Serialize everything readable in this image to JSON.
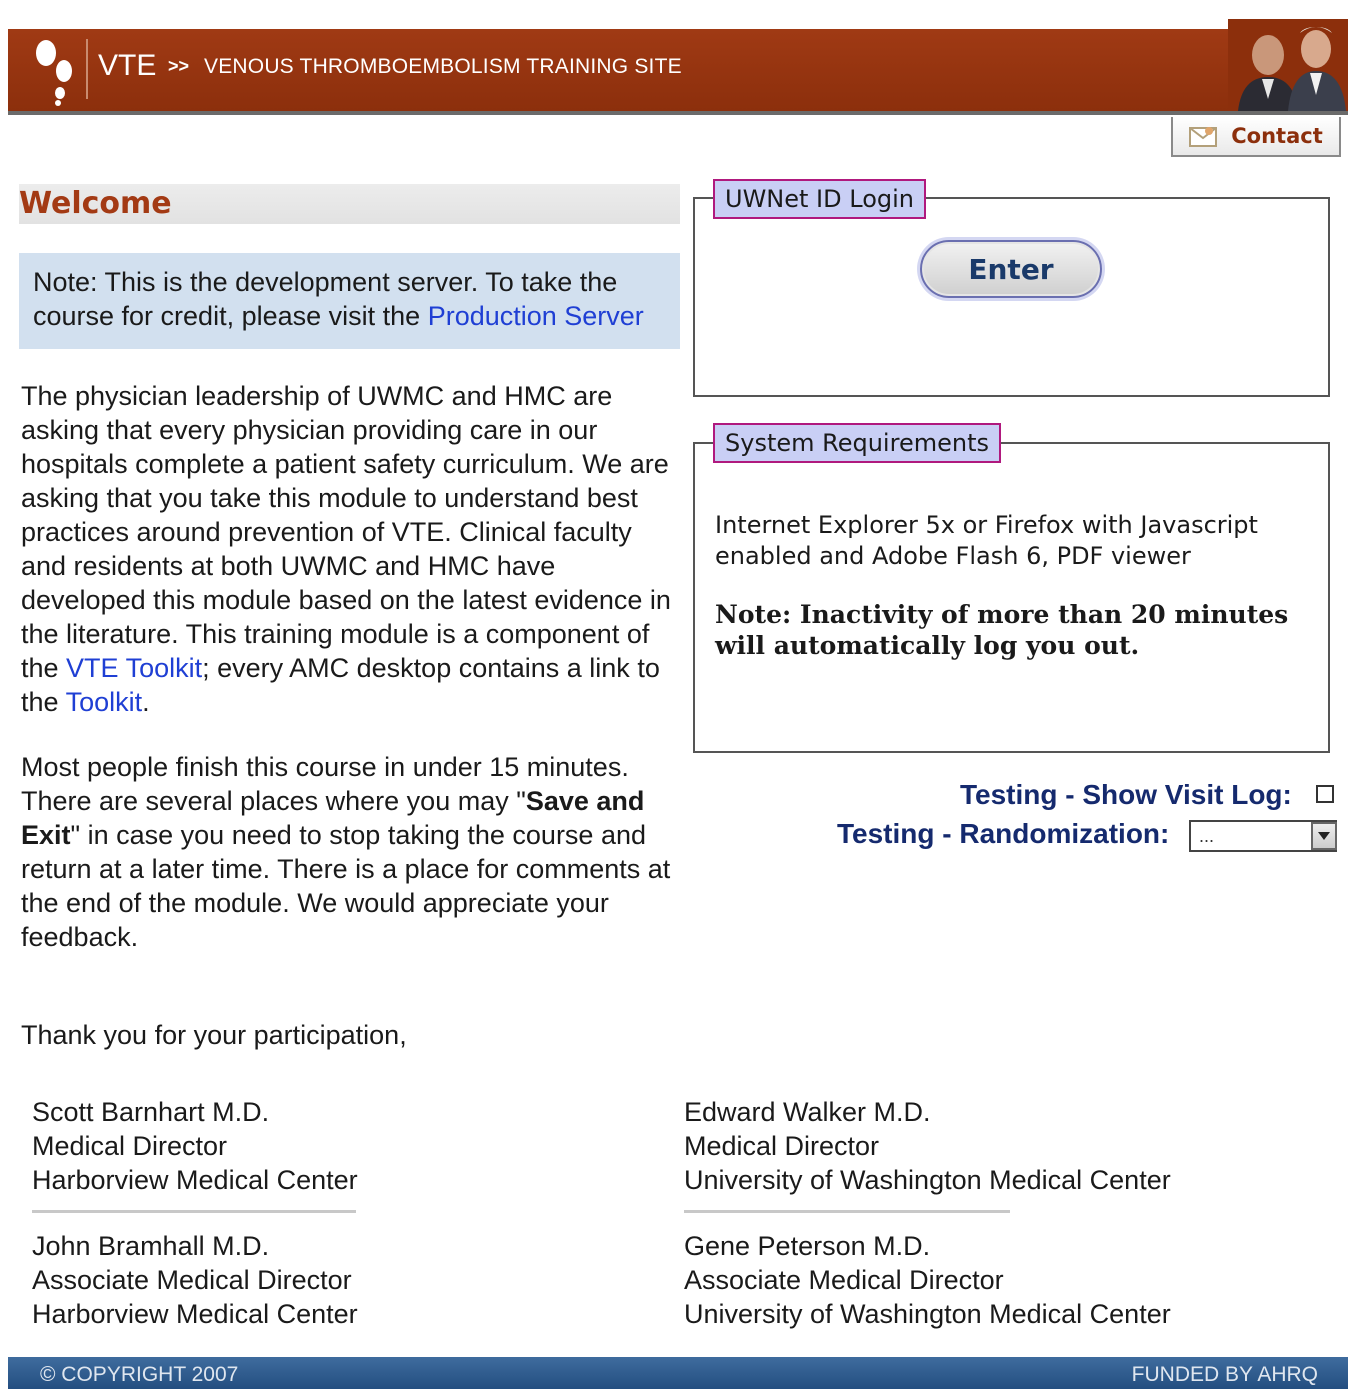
{
  "header": {
    "brand": "VTE",
    "separator": ">>",
    "subtitle": "VENOUS THROMBOEMBOLISM TRAINING SITE"
  },
  "contact": {
    "label": "Contact"
  },
  "welcome": {
    "title": "Welcome"
  },
  "note": {
    "text": "Note: This is the development server. To take the course for credit, please visit the ",
    "link": "Production Server"
  },
  "intro": {
    "p1_a": "The physician leadership of UWMC and HMC are asking that every physician providing care in our hospitals complete a patient safety curriculum. We are asking that you take this module to understand best practices around prevention of VTE. Clinical faculty and residents at both UWMC and HMC have developed this module based on the latest evidence in the literature. This training module is a component of the ",
    "p1_link1": "VTE Toolkit",
    "p1_b": "; every AMC desktop contains a link to the ",
    "p1_link2": "Toolkit",
    "p1_c": ".",
    "p2_a": "Most people finish this course in under 15 minutes. There are several places where you may \"",
    "p2_bold": "Save and Exit",
    "p2_b": "\" in case you need to stop taking the course and return at a later time. There is a place for comments at the end of the module. We would appreciate your feedback.",
    "thanks": "Thank you for your participation,"
  },
  "signatures": [
    {
      "name": "Scott Barnhart M.D.",
      "title": "Medical Director",
      "org": "Harborview Medical Center"
    },
    {
      "name": "Edward Walker M.D.",
      "title": "Medical Director",
      "org": "University of Washington Medical Center"
    },
    {
      "name": "John Bramhall M.D.",
      "title": "Associate Medical Director",
      "org": "Harborview Medical Center"
    },
    {
      "name": "Gene Peterson M.D.",
      "title": "Associate Medical Director",
      "org": "University of Washington Medical Center"
    }
  ],
  "login": {
    "legend": "UWNet ID Login",
    "button": "Enter"
  },
  "requirements": {
    "legend": "System Requirements",
    "text": "Internet Explorer 5x or Firefox with Javascript enabled and Adobe Flash 6, PDF viewer",
    "note": "Note: Inactivity of more than 20 minutes will automatically log you out."
  },
  "testing": {
    "visit_log_label": "Testing - Show Visit Log:",
    "randomization_label": "Testing - Randomization:",
    "randomization_value": "..."
  },
  "footer": {
    "copyright": "© COPYRIGHT 2007",
    "funded": "FUNDED BY AHRQ"
  },
  "colors": {
    "header": "#8c2f0c",
    "link": "#1f3fd4",
    "note_bg": "#d2e0ef",
    "legend_bg": "#c9cff5",
    "testing_text": "#152a6e",
    "footer": "#234e80"
  }
}
